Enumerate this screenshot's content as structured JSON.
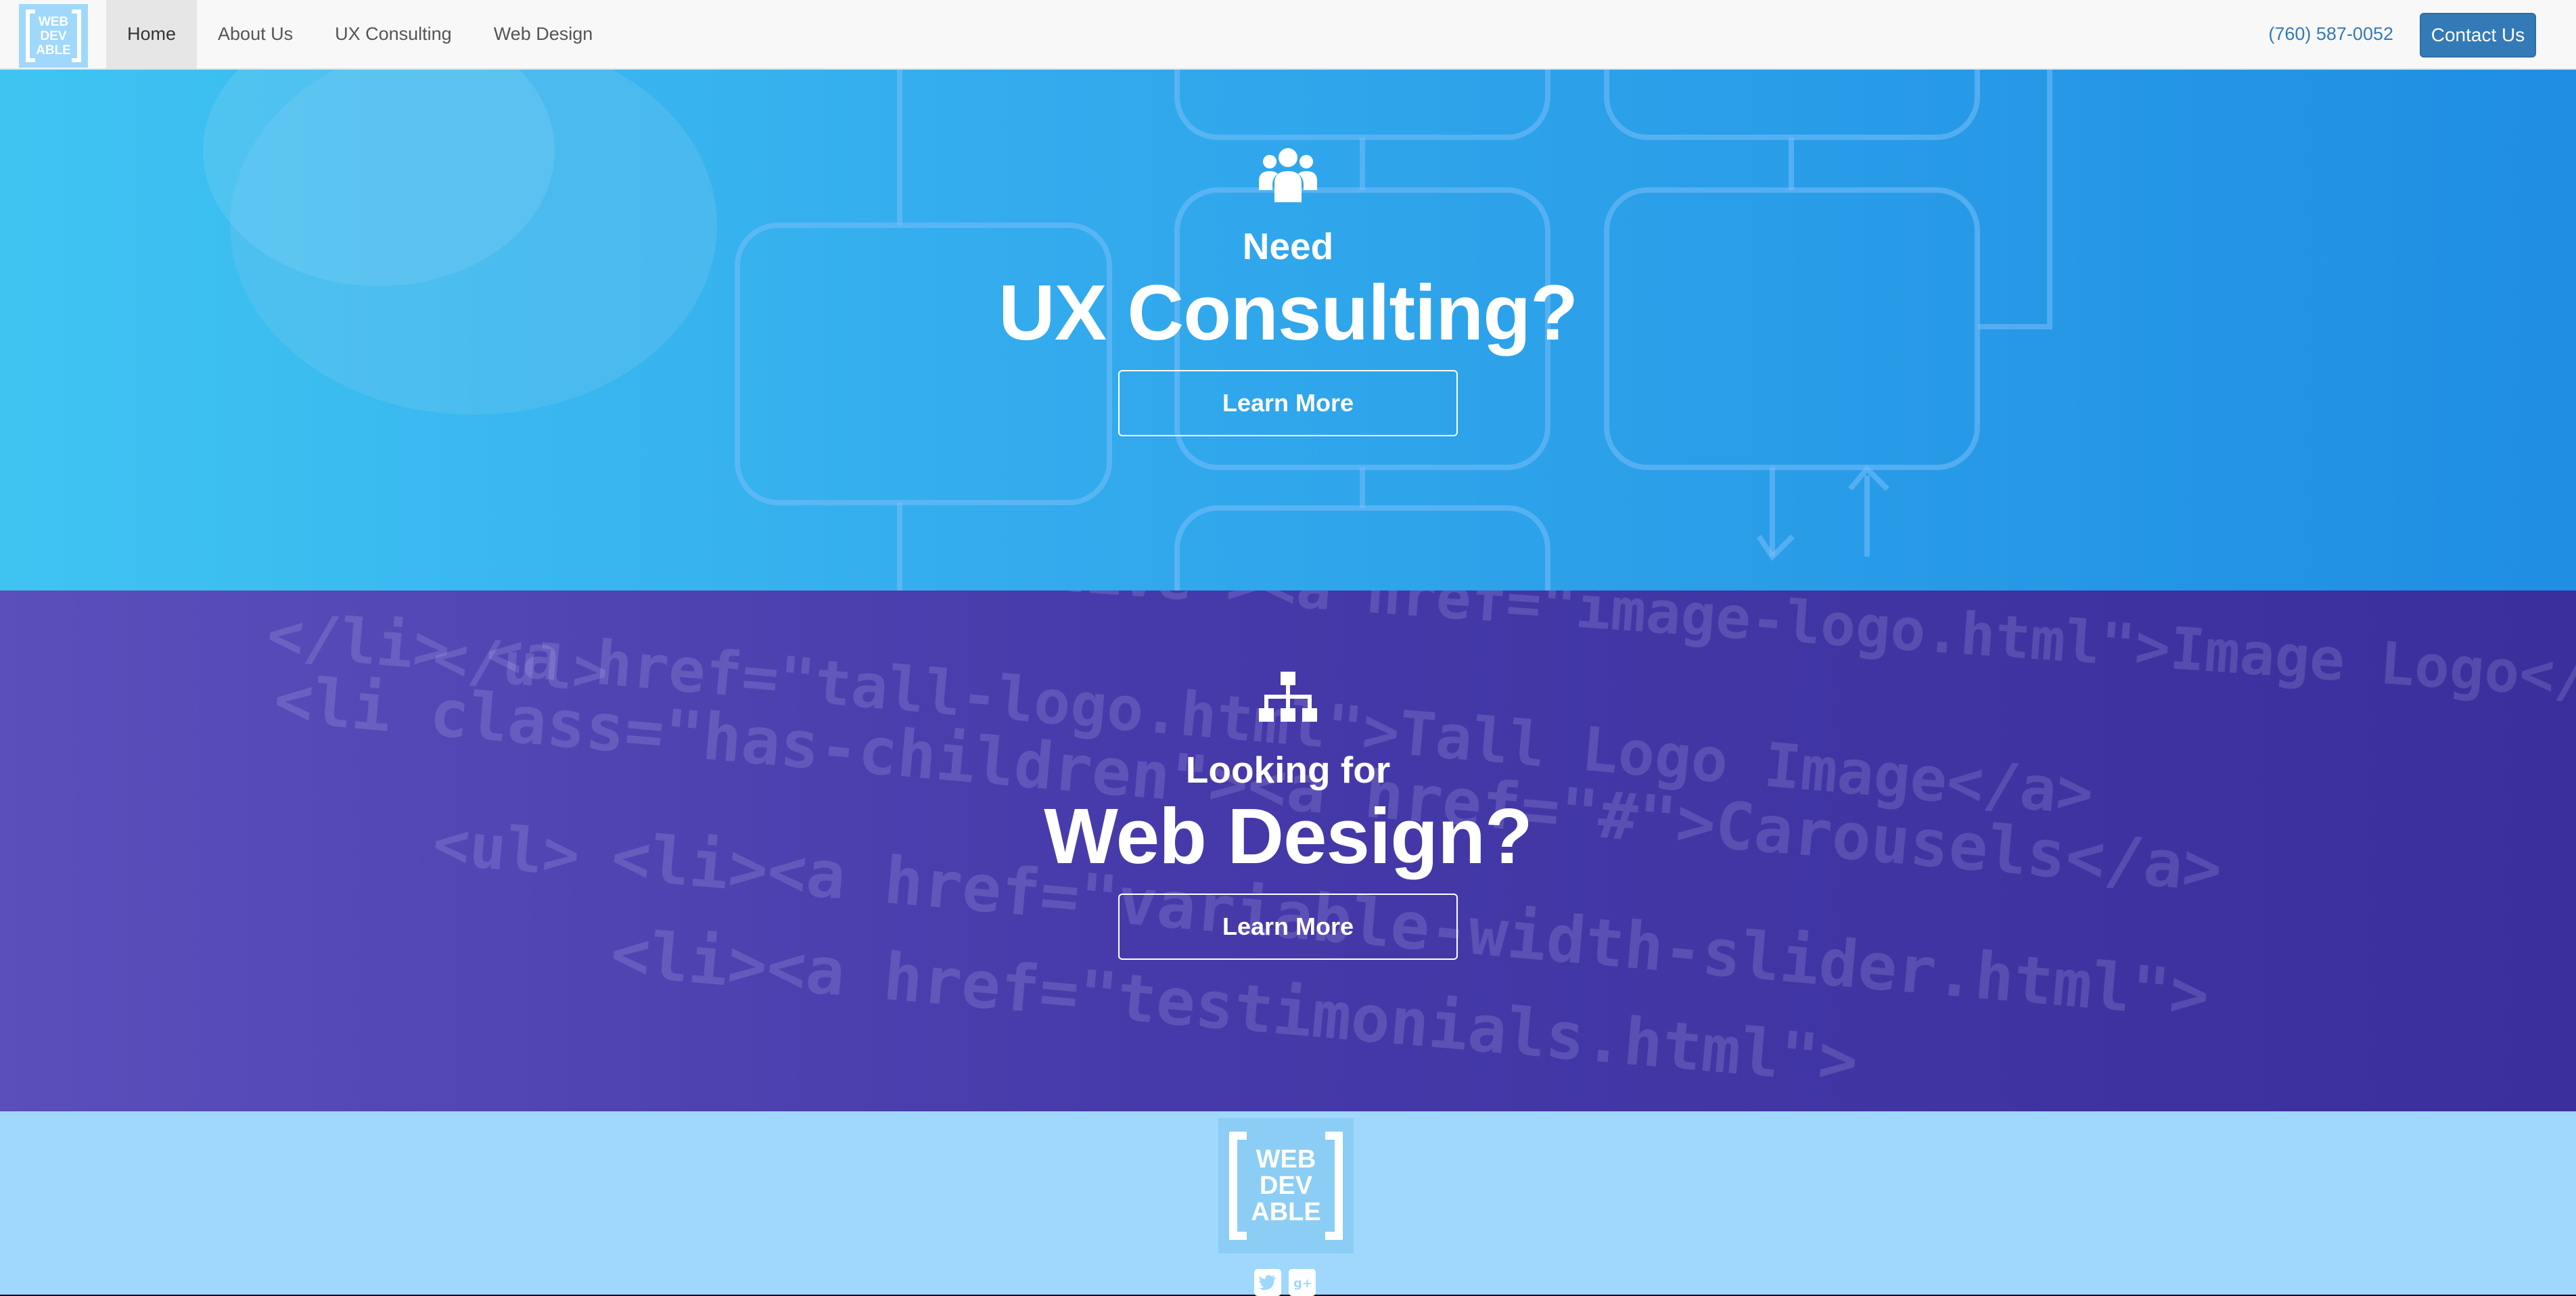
{
  "brand": {
    "logo_lines": [
      "WEB",
      "DEV",
      "ABLE"
    ]
  },
  "nav": {
    "items": [
      {
        "label": "Home",
        "active": true
      },
      {
        "label": "About Us",
        "active": false
      },
      {
        "label": "UX Consulting",
        "active": false
      },
      {
        "label": "Web Design",
        "active": false
      }
    ],
    "phone": "(760) 587-0052",
    "contact_label": "Contact Us"
  },
  "sections": [
    {
      "icon": "users-icon",
      "subtitle": "Need",
      "title": "UX Consulting?",
      "button": "Learn More"
    },
    {
      "icon": "sitemap-icon",
      "subtitle": "Looking for",
      "title": "Web Design?",
      "button": "Learn More"
    }
  ],
  "footer": {
    "logo_lines": [
      "WEB",
      "DEV",
      "ABLE"
    ],
    "social": [
      "twitter-icon",
      "google-plus-icon"
    ]
  },
  "colors": {
    "ux_bg": "#33abed",
    "web_bg": "#463aaa",
    "footer_bg": "#9fd8fc",
    "brand_blue": "#337ab7"
  }
}
